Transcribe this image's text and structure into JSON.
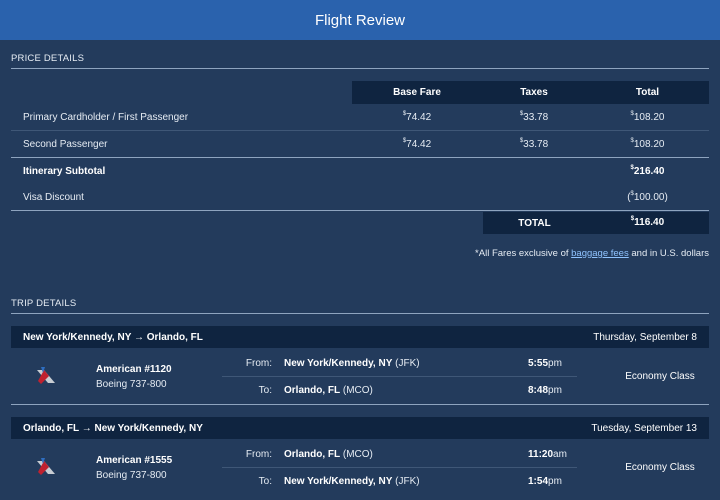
{
  "header": {
    "title": "Flight Review"
  },
  "price": {
    "section_label": "PRICE DETAILS",
    "columns": [
      "Base Fare",
      "Taxes",
      "Total"
    ],
    "currency_symbol": "$",
    "rows": [
      {
        "label": "Primary Cardholder / First Passenger",
        "base": "74.42",
        "tax": "33.78",
        "total": "108.20"
      },
      {
        "label": "Second Passenger",
        "base": "74.42",
        "tax": "33.78",
        "total": "108.20"
      }
    ],
    "subtotal": {
      "label": "Itinerary Subtotal",
      "total": "216.40"
    },
    "discount": {
      "label": "Visa Discount",
      "open": "(",
      "amount": "100.00",
      "close": ")"
    },
    "grand_total": {
      "label": "TOTAL",
      "total": "116.40"
    },
    "note": {
      "prefix": "*All Fares exclusive of ",
      "link": "baggage fees",
      "suffix": " and in U.S. dollars"
    }
  },
  "trip": {
    "section_label": "TRIP DETAILS",
    "legs": [
      {
        "route_from": "New York/Kennedy, NY",
        "arrow": "→",
        "route_to": "Orlando, FL",
        "date": "Thursday, September 8",
        "flight": "American #1120",
        "aircraft": "Boeing 737-800",
        "from_label": "From:",
        "from_city": "New York/Kennedy, NY",
        "from_code": "(JFK)",
        "dep_time": "5:55",
        "dep_ampm": "pm",
        "to_label": "To:",
        "to_city": "Orlando, FL",
        "to_code": "(MCO)",
        "arr_time": "8:48",
        "arr_ampm": "pm",
        "cabin": "Economy Class"
      },
      {
        "route_from": "Orlando, FL",
        "arrow": "→",
        "route_to": "New York/Kennedy, NY",
        "date": "Tuesday, September 13",
        "flight": "American #1555",
        "aircraft": "Boeing 737-800",
        "from_label": "From:",
        "from_city": "Orlando, FL",
        "from_code": "(MCO)",
        "dep_time": "11:20",
        "dep_ampm": "am",
        "to_label": "To:",
        "to_city": "New York/Kennedy, NY",
        "to_code": "(JFK)",
        "arr_time": "1:54",
        "arr_ampm": "pm",
        "cabin": "Economy Class"
      }
    ]
  },
  "icons": {
    "airline_logo": "american-airlines-logo-icon"
  },
  "colors": {
    "header": "#2a62ad",
    "background": "#233b5c",
    "bar": "#0f2440",
    "link": "#8fc3ff"
  }
}
